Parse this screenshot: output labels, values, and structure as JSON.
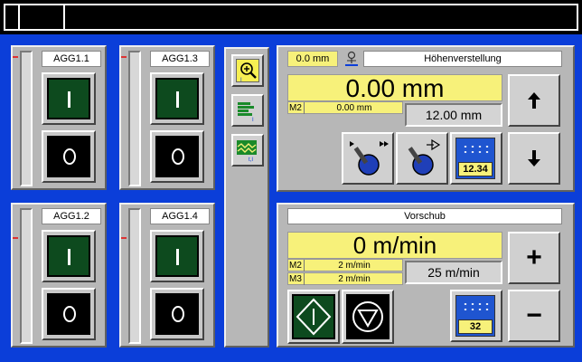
{
  "aggregates": [
    {
      "label": "AGG1.1",
      "on_symbol": "I",
      "off_symbol": "O"
    },
    {
      "label": "AGG1.3",
      "on_symbol": "I",
      "off_symbol": "O"
    },
    {
      "label": "AGG1.2",
      "on_symbol": "I",
      "off_symbol": "O"
    },
    {
      "label": "AGG1.4",
      "on_symbol": "I",
      "off_symbol": "O"
    }
  ],
  "tools": [
    {
      "icon": "zoom-in-icon"
    },
    {
      "icon": "bar-list-icon"
    },
    {
      "icon": "waveform-icon"
    }
  ],
  "height": {
    "title": "Höhenverstellung",
    "small_value": "0.0 mm",
    "main_value": "0.00 mm",
    "m2_tag": "M2",
    "m2_value": "0.00 mm",
    "setpoint": "12.00 mm",
    "keypad_number": "12.34"
  },
  "feed": {
    "title": "Vorschub",
    "main_value": "0 m/min",
    "m2_tag": "M2",
    "m2_value": "2 m/min",
    "m3_tag": "M3",
    "m3_value": "2 m/min",
    "setpoint": "25 m/min",
    "keypad_number": "32",
    "plus": "+",
    "minus": "−"
  },
  "colors": {
    "background_blue": "#0b3ed9",
    "panel_grey": "#b7b7b7",
    "value_yellow": "#f7f17a",
    "on_green": "#0d4a1e"
  }
}
